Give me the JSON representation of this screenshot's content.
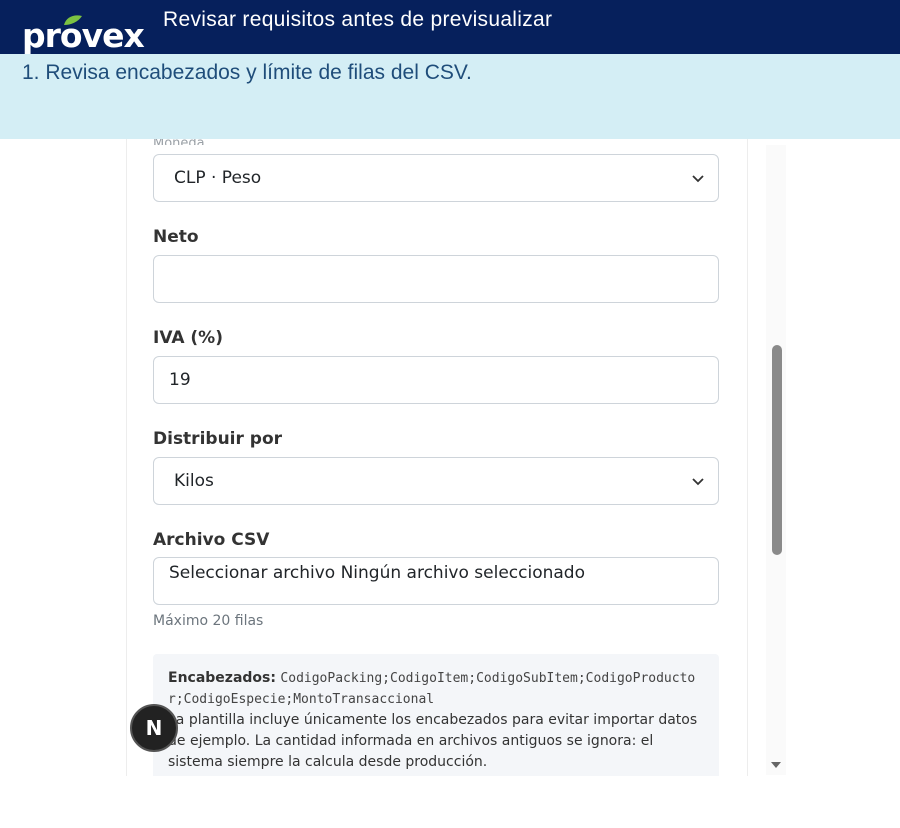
{
  "header": {
    "logo_text": "provex",
    "title": "Revisar requisitos antes de previsualizar",
    "brand_color": "#06205c",
    "leaf_color": "#7cc242"
  },
  "info": {
    "step": "1. Revisa encabezados y límite de filas del CSV."
  },
  "form": {
    "currency": {
      "value": "CLP · Peso"
    },
    "neto": {
      "label": "Neto",
      "value": ""
    },
    "iva": {
      "label": "IVA (%)",
      "value": "19"
    },
    "distribuir": {
      "label": "Distribuir por",
      "value": "Kilos"
    },
    "archivo": {
      "label": "Archivo CSV",
      "value": "Seleccionar archivo Ningún archivo seleccionado",
      "help": "Máximo 20 filas"
    }
  },
  "note": {
    "headers_label": "Encabezados:",
    "headers_code": "CodigoPacking;CodigoItem;CodigoSubItem;CodigoProductor;CodigoEspecie;MontoTransaccional",
    "body": "La plantilla incluye únicamente los encabezados para evitar importar datos de ejemplo. La cantidad informada en archivos antiguos se ignora: el sistema siempre la calcula desde producción."
  },
  "avatar": {
    "initial": "N"
  }
}
